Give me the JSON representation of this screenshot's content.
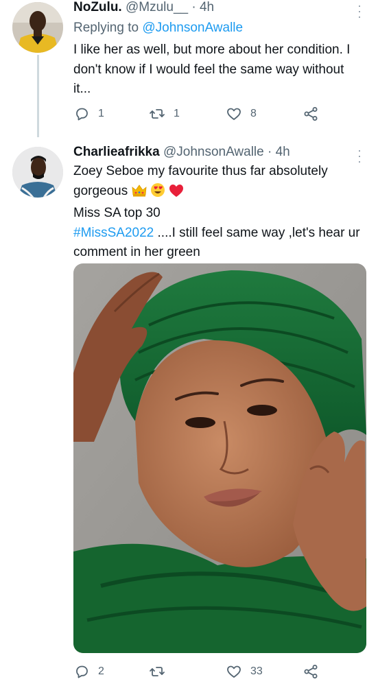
{
  "tweets": [
    {
      "name": "NoZulu.",
      "handle": "@Mzulu__",
      "time": "· 4h",
      "reply_prefix": "Replying to",
      "reply_to": "@JohnsonAwalle",
      "text": "I like her as well, but more about her condition. I don't know if I would feel the same way without it...",
      "replies": "1",
      "retweets": "1",
      "likes": "8"
    },
    {
      "name": "Charlieafrikka",
      "handle": "@JohnsonAwalle",
      "time": "· 4h",
      "text_line1": "Zoey Seboe my favourite thus far absolutely gorgeous",
      "text_line2": "Miss SA top 30",
      "hashtag": "#MissSA2022",
      "text_line3": " ....I still feel same way ,let's hear ur comment in her green",
      "replies": "2",
      "retweets": "",
      "likes": "33"
    }
  ],
  "colors": {
    "accent": "#1d9bf0",
    "muted": "#536471",
    "text": "#0f1419"
  },
  "icons": [
    "more-icon",
    "reply-icon",
    "retweet-icon",
    "like-icon",
    "share-icon",
    "crown-emoji-icon",
    "heart-eyes-emoji-icon",
    "red-heart-emoji-icon"
  ]
}
